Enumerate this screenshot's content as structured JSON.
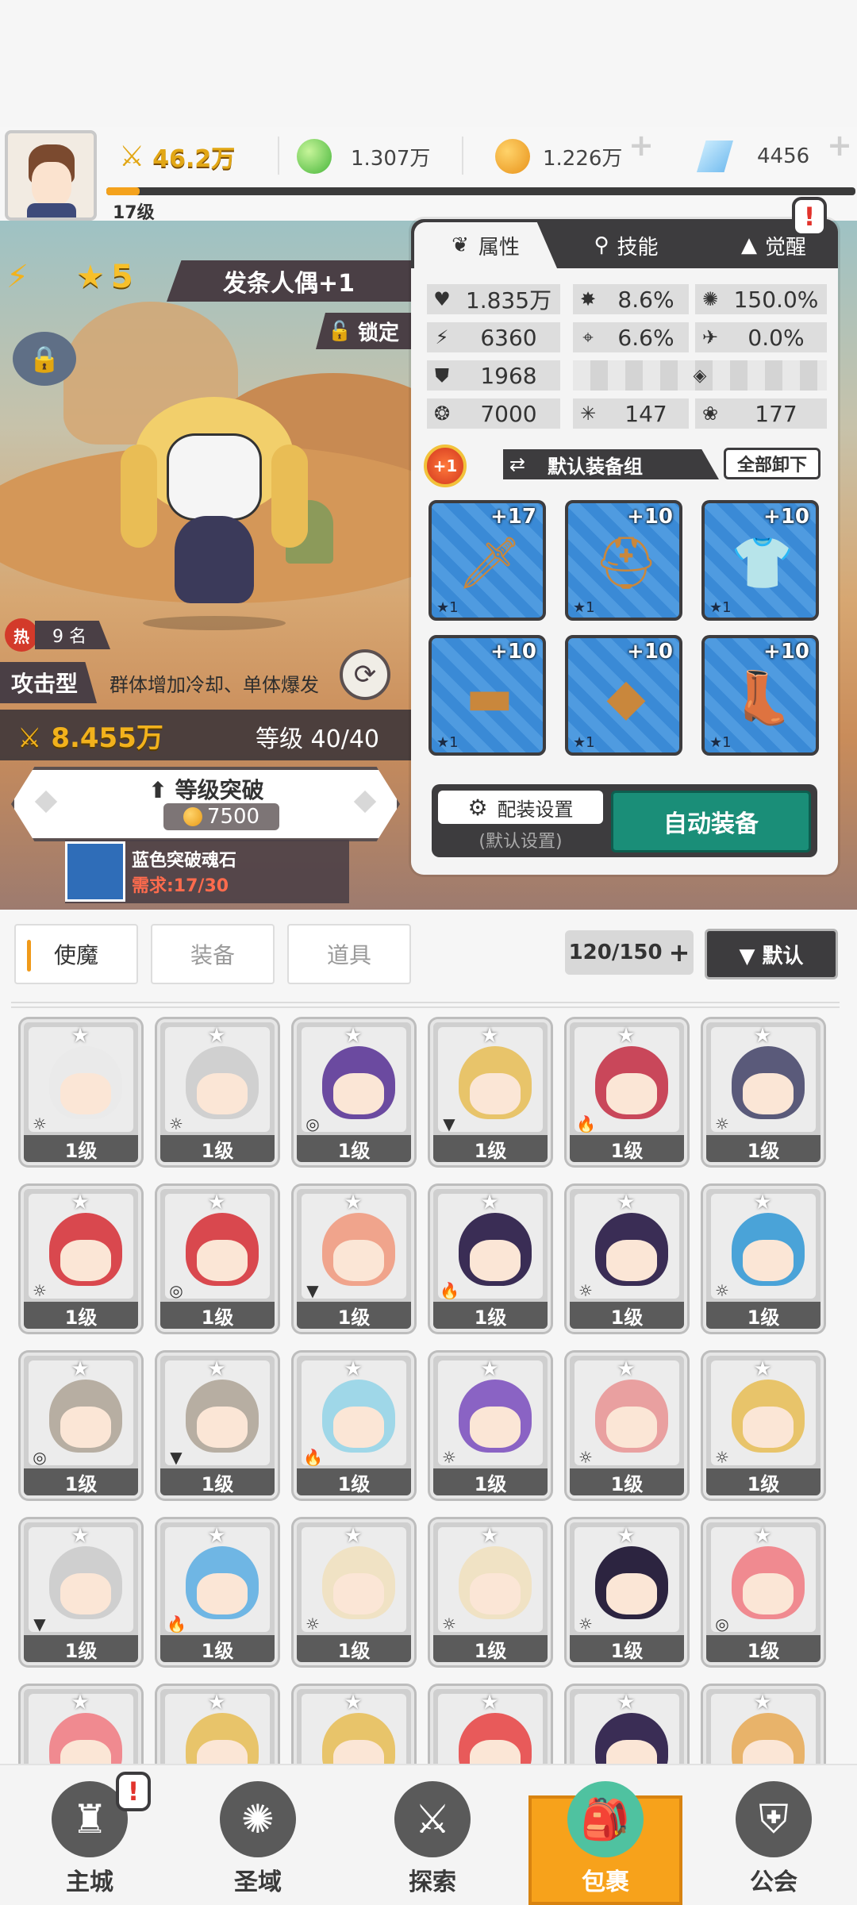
{
  "player": {
    "level": "17级"
  },
  "currency": {
    "power": "46.2万",
    "green_gem": "1.307万",
    "gold": "1.226万",
    "diamond": "4456"
  },
  "hero": {
    "star": "5",
    "name": "发条人偶+1",
    "lock_label": "锁定",
    "hot_icon": "热",
    "hot_count": "9 名",
    "type": "攻击型",
    "desc": "群体增加冷却、单体爆发",
    "power": "8.455万",
    "grade": "等级 40/40",
    "breakthrough_label": "等级突破",
    "breakthrough_cost": "7500",
    "stone_name": "蓝色突破魂石",
    "stone_need": "需求:17/30"
  },
  "panel": {
    "tabs": [
      "属性",
      "技能",
      "觉醒"
    ],
    "stats": {
      "hp": "1.835万",
      "crit": "8.6%",
      "crit_dmg": "150.0%",
      "atk": "6360",
      "hit": "6.6%",
      "dodge": "0.0%",
      "def": "1968",
      "speed": "7000",
      "s2": "147",
      "s3": "177"
    },
    "plus_badge": "+1",
    "set_name": "默认装备组",
    "unload_all": "全部卸下",
    "slots": [
      {
        "level": "+17",
        "star": "★1",
        "icon": "sword-icon"
      },
      {
        "level": "+10",
        "star": "★1",
        "icon": "helmet-icon"
      },
      {
        "level": "+10",
        "star": "★1",
        "icon": "armor-icon"
      },
      {
        "level": "+10",
        "star": "★1",
        "icon": "belt-icon"
      },
      {
        "level": "+10",
        "star": "★1",
        "icon": "necklace-icon"
      },
      {
        "level": "+10",
        "star": "★1",
        "icon": "boots-icon"
      }
    ],
    "config_label": "配装设置",
    "config_sub": "(默认设置)",
    "auto_equip": "自动装备"
  },
  "list": {
    "tabs": [
      "使魔",
      "装备",
      "道具"
    ],
    "count": "120/150",
    "sort_label": "▼ 默认",
    "card_level": "1级"
  },
  "nav": [
    "主城",
    "圣域",
    "探索",
    "包裹",
    "公会"
  ],
  "colors": {
    "accent": "#f7a21b",
    "auto_button": "#1a8e78",
    "dark": "#3d3c3e"
  }
}
